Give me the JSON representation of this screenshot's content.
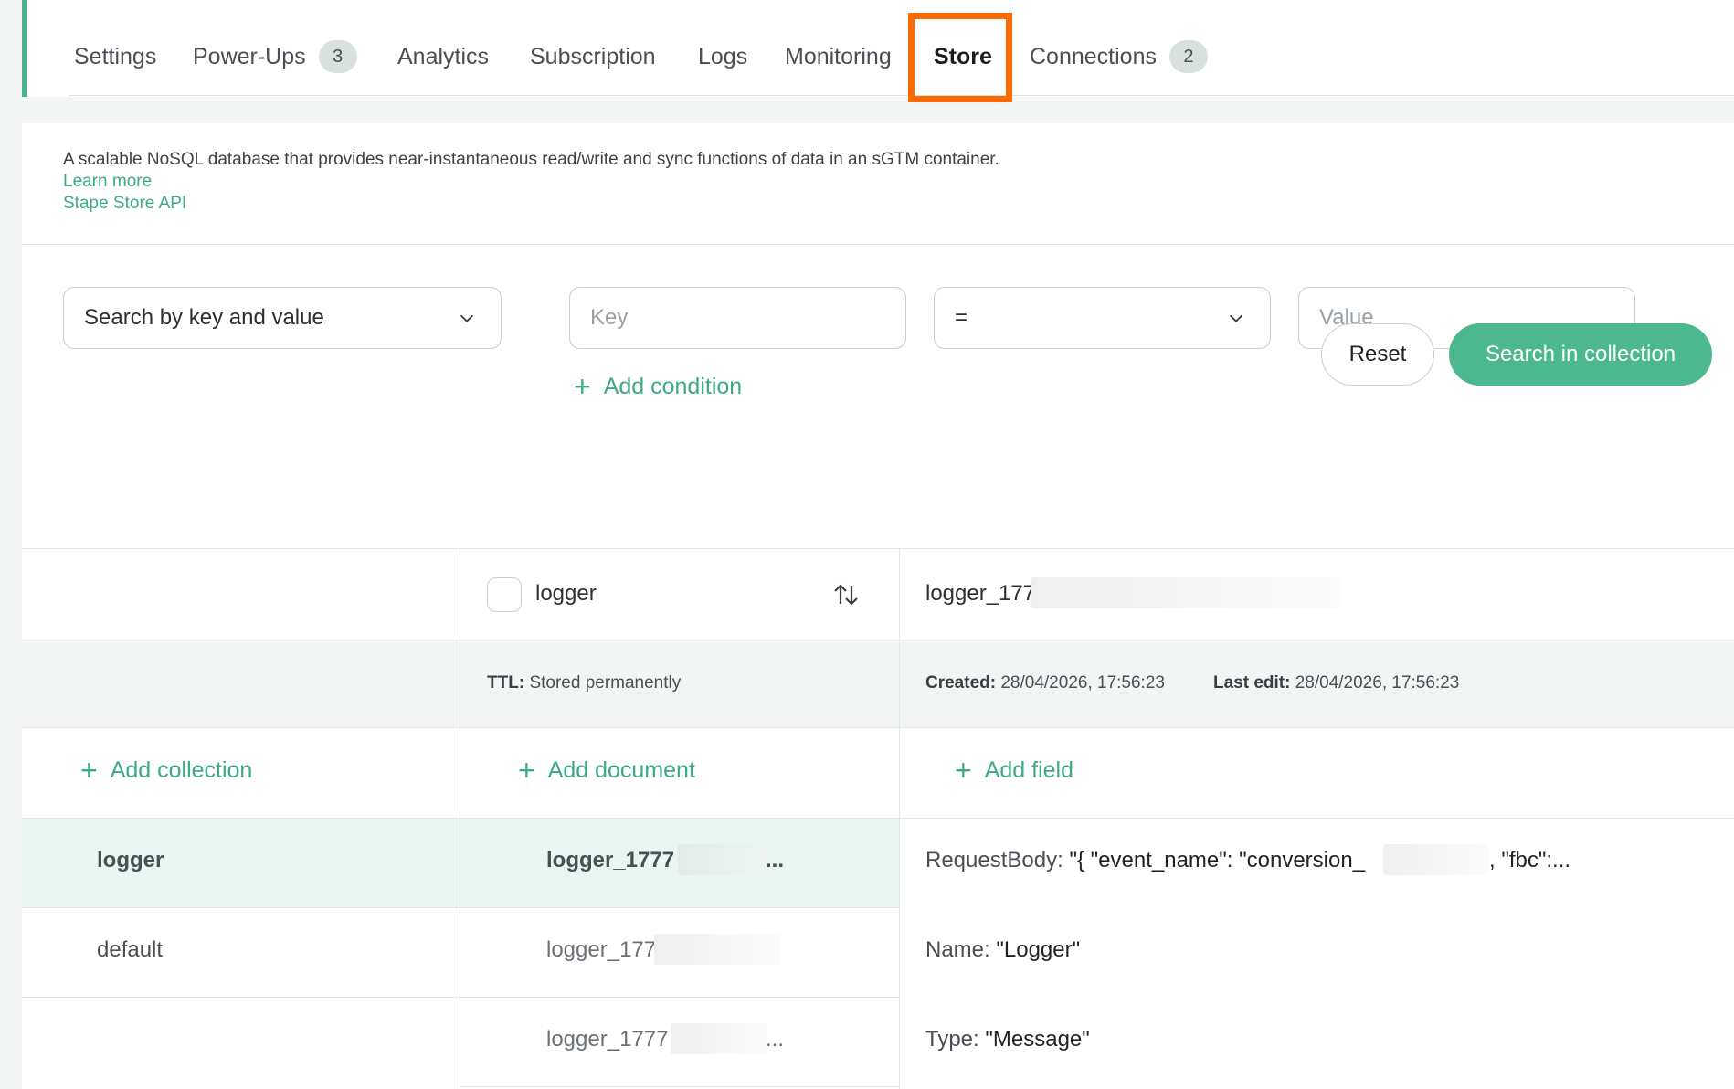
{
  "tabs": [
    {
      "label": "Settings"
    },
    {
      "label": "Power-Ups",
      "count": "3"
    },
    {
      "label": "Analytics"
    },
    {
      "label": "Subscription"
    },
    {
      "label": "Logs"
    },
    {
      "label": "Monitoring"
    },
    {
      "label": "Store",
      "active": true
    },
    {
      "label": "Connections",
      "count": "2"
    }
  ],
  "info": {
    "description": "A scalable NoSQL database that provides near-instantaneous read/write and sync functions of data in an sGTM container.",
    "learn_more": "Learn more",
    "api_link": "Stape Store API"
  },
  "search": {
    "mode_value": "Search by key and value",
    "key_placeholder": "Key",
    "operator_value": "=",
    "value_placeholder": "Value",
    "add_condition": "Add condition",
    "reset_label": "Reset",
    "search_label": "Search in collection"
  },
  "document_header": {
    "collection_name": "logger",
    "document_id": "logger_177",
    "ttl_label": "TTL:",
    "ttl_value": "Stored permanently",
    "created_label": "Created:",
    "created_value": "28/04/2026, 17:56:23",
    "last_edit_label": "Last edit:",
    "last_edit_value": "28/04/2026, 17:56:23"
  },
  "actions": {
    "add_collection": "Add collection",
    "add_document": "Add document",
    "add_field": "Add field"
  },
  "collections": [
    {
      "name": "logger",
      "selected": true
    },
    {
      "name": "default"
    }
  ],
  "documents": [
    {
      "id": "logger_1777",
      "suffix": "...",
      "selected": true
    },
    {
      "id": "logger_177",
      "suffix": ""
    },
    {
      "id": "logger_1777",
      "suffix": "..."
    }
  ],
  "fields": [
    {
      "key": "RequestBody:",
      "value": "\"{ \"event_name\": \"conversion_",
      "value_tail": ", \"fbc\":..."
    },
    {
      "key": "Name:",
      "value": "\"Logger\""
    },
    {
      "key": "Type:",
      "value": "\"Message\""
    }
  ],
  "colors": {
    "accent": "#4cb88f",
    "highlight": "#ff6a00"
  }
}
